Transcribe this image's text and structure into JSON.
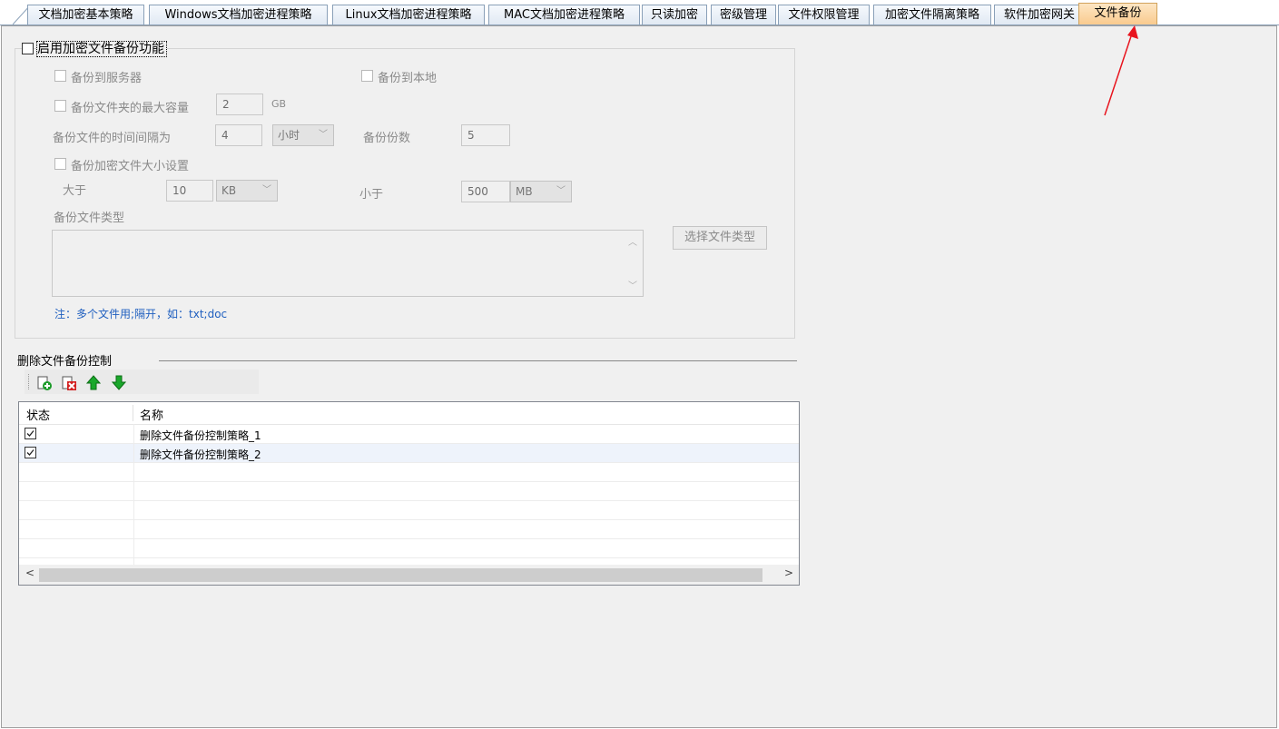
{
  "tabs": [
    {
      "label": "文档加密基本策略",
      "active": false
    },
    {
      "label": "Windows文档加密进程策略",
      "active": false
    },
    {
      "label": "Linux文档加密进程策略",
      "active": false
    },
    {
      "label": "MAC文档加密进程策略",
      "active": false
    },
    {
      "label": "只读加密",
      "active": false
    },
    {
      "label": "密级管理",
      "active": false
    },
    {
      "label": "文件权限管理",
      "active": false
    },
    {
      "label": "加密文件隔离策略",
      "active": false
    },
    {
      "label": "软件加密网关",
      "active": false
    },
    {
      "label": "文件备份",
      "active": true
    }
  ],
  "backup": {
    "enable_label": "启用加密文件备份功能",
    "enabled": false,
    "to_server_label": "备份到服务器",
    "to_local_label": "备份到本地",
    "max_capacity_label": "备份文件夹的最大容量",
    "max_capacity_value": "2",
    "max_capacity_unit": "GB",
    "interval_label": "备份文件的时间间隔为",
    "interval_value": "4",
    "interval_unit": "小时",
    "copies_label": "备份份数",
    "copies_value": "5",
    "size_setting_label": "备份加密文件大小设置",
    "greater_label": "大于",
    "greater_value": "10",
    "greater_unit": "KB",
    "less_label": "小于",
    "less_value": "500",
    "less_unit": "MB",
    "file_types_label": "备份文件类型",
    "file_types_value": "",
    "choose_types_button": "选择文件类型",
    "note": "注：多个文件用;隔开，如：txt;doc"
  },
  "delete_control": {
    "title": "删除文件备份控制",
    "columns": [
      "状态",
      "名称"
    ],
    "rows": [
      {
        "checked": true,
        "name": "删除文件备份控制策略_1"
      },
      {
        "checked": true,
        "name": "删除文件备份控制策略_2"
      }
    ]
  },
  "colors": {
    "active_tab": "#f9c98c",
    "note_text": "#1f5fbf",
    "panel_bg": "#f0f0f0",
    "arrow": "#e8141e"
  }
}
